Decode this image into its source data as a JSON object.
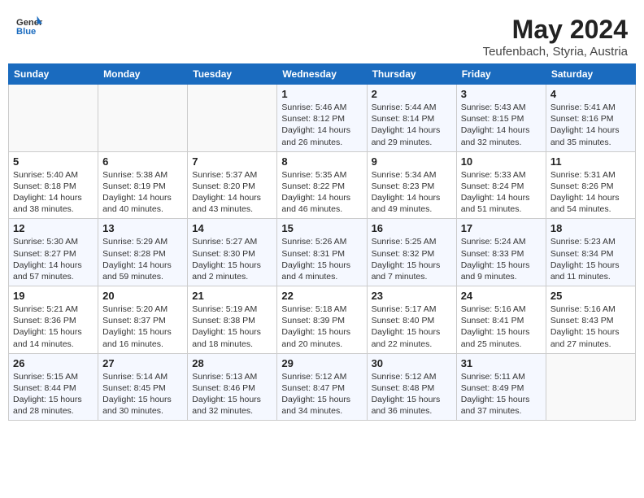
{
  "header": {
    "logo_line1": "General",
    "logo_line2": "Blue",
    "main_title": "May 2024",
    "subtitle": "Teufenbach, Styria, Austria"
  },
  "calendar": {
    "days_of_week": [
      "Sunday",
      "Monday",
      "Tuesday",
      "Wednesday",
      "Thursday",
      "Friday",
      "Saturday"
    ],
    "weeks": [
      [
        {
          "day": "",
          "info": ""
        },
        {
          "day": "",
          "info": ""
        },
        {
          "day": "",
          "info": ""
        },
        {
          "day": "1",
          "info": "Sunrise: 5:46 AM\nSunset: 8:12 PM\nDaylight: 14 hours\nand 26 minutes."
        },
        {
          "day": "2",
          "info": "Sunrise: 5:44 AM\nSunset: 8:14 PM\nDaylight: 14 hours\nand 29 minutes."
        },
        {
          "day": "3",
          "info": "Sunrise: 5:43 AM\nSunset: 8:15 PM\nDaylight: 14 hours\nand 32 minutes."
        },
        {
          "day": "4",
          "info": "Sunrise: 5:41 AM\nSunset: 8:16 PM\nDaylight: 14 hours\nand 35 minutes."
        }
      ],
      [
        {
          "day": "5",
          "info": "Sunrise: 5:40 AM\nSunset: 8:18 PM\nDaylight: 14 hours\nand 38 minutes."
        },
        {
          "day": "6",
          "info": "Sunrise: 5:38 AM\nSunset: 8:19 PM\nDaylight: 14 hours\nand 40 minutes."
        },
        {
          "day": "7",
          "info": "Sunrise: 5:37 AM\nSunset: 8:20 PM\nDaylight: 14 hours\nand 43 minutes."
        },
        {
          "day": "8",
          "info": "Sunrise: 5:35 AM\nSunset: 8:22 PM\nDaylight: 14 hours\nand 46 minutes."
        },
        {
          "day": "9",
          "info": "Sunrise: 5:34 AM\nSunset: 8:23 PM\nDaylight: 14 hours\nand 49 minutes."
        },
        {
          "day": "10",
          "info": "Sunrise: 5:33 AM\nSunset: 8:24 PM\nDaylight: 14 hours\nand 51 minutes."
        },
        {
          "day": "11",
          "info": "Sunrise: 5:31 AM\nSunset: 8:26 PM\nDaylight: 14 hours\nand 54 minutes."
        }
      ],
      [
        {
          "day": "12",
          "info": "Sunrise: 5:30 AM\nSunset: 8:27 PM\nDaylight: 14 hours\nand 57 minutes."
        },
        {
          "day": "13",
          "info": "Sunrise: 5:29 AM\nSunset: 8:28 PM\nDaylight: 14 hours\nand 59 minutes."
        },
        {
          "day": "14",
          "info": "Sunrise: 5:27 AM\nSunset: 8:30 PM\nDaylight: 15 hours\nand 2 minutes."
        },
        {
          "day": "15",
          "info": "Sunrise: 5:26 AM\nSunset: 8:31 PM\nDaylight: 15 hours\nand 4 minutes."
        },
        {
          "day": "16",
          "info": "Sunrise: 5:25 AM\nSunset: 8:32 PM\nDaylight: 15 hours\nand 7 minutes."
        },
        {
          "day": "17",
          "info": "Sunrise: 5:24 AM\nSunset: 8:33 PM\nDaylight: 15 hours\nand 9 minutes."
        },
        {
          "day": "18",
          "info": "Sunrise: 5:23 AM\nSunset: 8:34 PM\nDaylight: 15 hours\nand 11 minutes."
        }
      ],
      [
        {
          "day": "19",
          "info": "Sunrise: 5:21 AM\nSunset: 8:36 PM\nDaylight: 15 hours\nand 14 minutes."
        },
        {
          "day": "20",
          "info": "Sunrise: 5:20 AM\nSunset: 8:37 PM\nDaylight: 15 hours\nand 16 minutes."
        },
        {
          "day": "21",
          "info": "Sunrise: 5:19 AM\nSunset: 8:38 PM\nDaylight: 15 hours\nand 18 minutes."
        },
        {
          "day": "22",
          "info": "Sunrise: 5:18 AM\nSunset: 8:39 PM\nDaylight: 15 hours\nand 20 minutes."
        },
        {
          "day": "23",
          "info": "Sunrise: 5:17 AM\nSunset: 8:40 PM\nDaylight: 15 hours\nand 22 minutes."
        },
        {
          "day": "24",
          "info": "Sunrise: 5:16 AM\nSunset: 8:41 PM\nDaylight: 15 hours\nand 25 minutes."
        },
        {
          "day": "25",
          "info": "Sunrise: 5:16 AM\nSunset: 8:43 PM\nDaylight: 15 hours\nand 27 minutes."
        }
      ],
      [
        {
          "day": "26",
          "info": "Sunrise: 5:15 AM\nSunset: 8:44 PM\nDaylight: 15 hours\nand 28 minutes."
        },
        {
          "day": "27",
          "info": "Sunrise: 5:14 AM\nSunset: 8:45 PM\nDaylight: 15 hours\nand 30 minutes."
        },
        {
          "day": "28",
          "info": "Sunrise: 5:13 AM\nSunset: 8:46 PM\nDaylight: 15 hours\nand 32 minutes."
        },
        {
          "day": "29",
          "info": "Sunrise: 5:12 AM\nSunset: 8:47 PM\nDaylight: 15 hours\nand 34 minutes."
        },
        {
          "day": "30",
          "info": "Sunrise: 5:12 AM\nSunset: 8:48 PM\nDaylight: 15 hours\nand 36 minutes."
        },
        {
          "day": "31",
          "info": "Sunrise: 5:11 AM\nSunset: 8:49 PM\nDaylight: 15 hours\nand 37 minutes."
        },
        {
          "day": "",
          "info": ""
        }
      ]
    ]
  }
}
